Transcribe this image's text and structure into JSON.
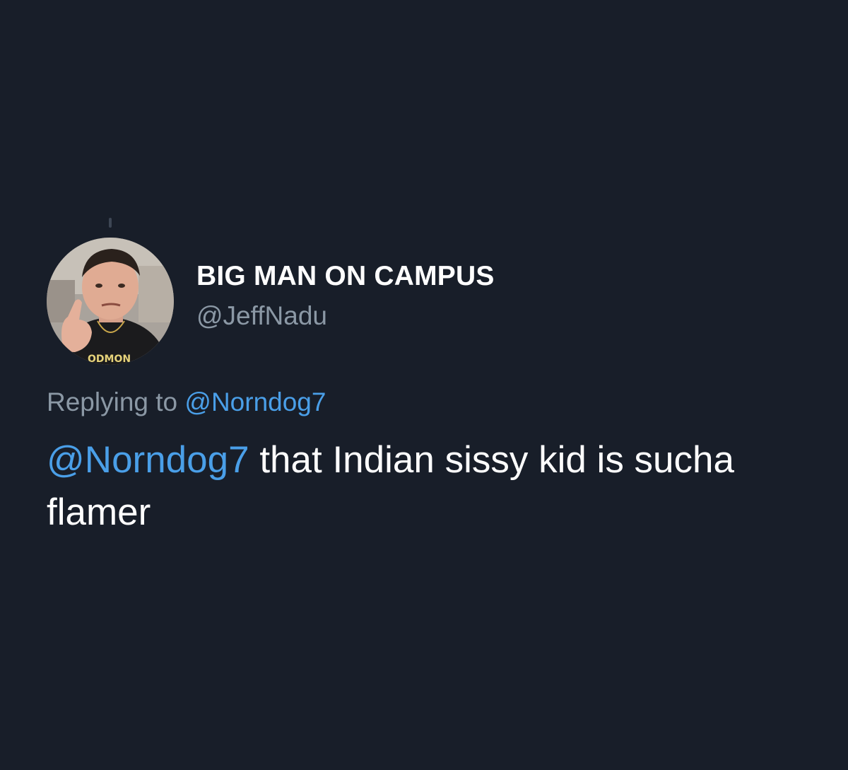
{
  "tweet": {
    "display_name": "BIG MAN ON CAMPUS",
    "handle": "@JeffNadu",
    "replying_to_prefix": "Replying to",
    "replying_to_handle": "@Norndog7",
    "body_mention": "@Norndog7",
    "body_text": " that Indian sissy kid is sucha flamer",
    "avatar_shirt_text": "ODMON"
  },
  "colors": {
    "background": "#181e29",
    "primary_text": "#ffffff",
    "secondary_text": "#8b98a5",
    "link": "#4a9fe8"
  }
}
